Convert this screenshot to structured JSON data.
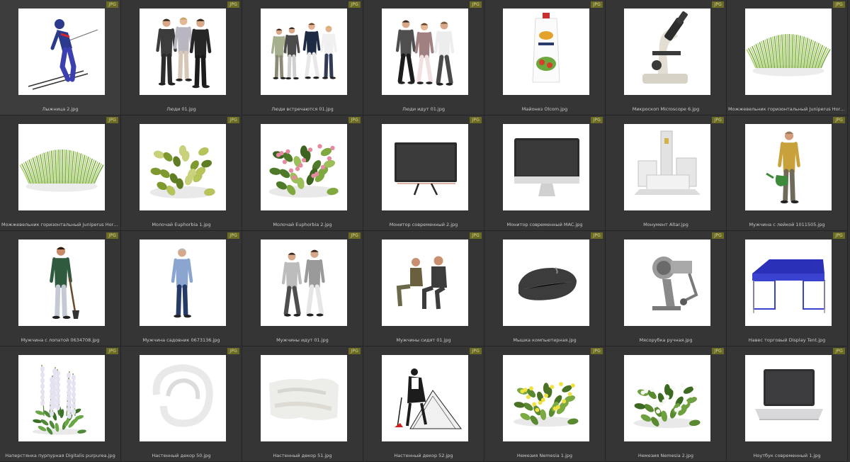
{
  "file_type_badge": "JPG",
  "items": [
    {
      "name": "Лыжница 2.jpg",
      "icon": "skier-icon"
    },
    {
      "name": "Люди 01.jpg",
      "icon": "people-group-icon"
    },
    {
      "name": "Люди встречаются 01.jpg",
      "icon": "people-meeting-icon"
    },
    {
      "name": "Люди идут 01.jpg",
      "icon": "people-walking-icon"
    },
    {
      "name": "Майонез Olcom.jpg",
      "icon": "mayonnaise-pack-icon"
    },
    {
      "name": "Микроскоп Microscope 6.jpg",
      "icon": "microscope-icon"
    },
    {
      "name": "Можжевельник горизонтальный Juniperus Horizontalis 2...",
      "icon": "juniper-shrub-icon"
    },
    {
      "name": "Можжевельник горизонтальный Juniperus Horizontalis 1...",
      "icon": "juniper-shrub-icon"
    },
    {
      "name": "Молочай Euphorbia 1.jpg",
      "icon": "euphorbia-plant-icon"
    },
    {
      "name": "Молочай Euphorbia 2.jpg",
      "icon": "euphorbia-plant-icon"
    },
    {
      "name": "Монитор современный 2.jpg",
      "icon": "monitor-icon"
    },
    {
      "name": "Монитор современный MAC.jpg",
      "icon": "imac-monitor-icon"
    },
    {
      "name": "Монумент Altar.jpg",
      "icon": "monument-icon"
    },
    {
      "name": "Мужчина с лейкой 1011505.jpg",
      "icon": "man-watering-can-icon"
    },
    {
      "name": "Мужчина с лопатой 0634708.jpg",
      "icon": "man-shovel-icon"
    },
    {
      "name": "Мужчина садовник 0673136.jpg",
      "icon": "man-gardener-icon"
    },
    {
      "name": "Мужчины идут 01.jpg",
      "icon": "men-walking-icon"
    },
    {
      "name": "Мужчины сидят 01.jpg",
      "icon": "men-sitting-icon"
    },
    {
      "name": "Мышка компьютерная.jpg",
      "icon": "computer-mouse-icon"
    },
    {
      "name": "Мясорубка ручная.jpg",
      "icon": "meat-grinder-icon"
    },
    {
      "name": "Навес торговый Display Tent.jpg",
      "icon": "display-tent-icon"
    },
    {
      "name": "Наперстянка пурпурная Digitalis purpurea.jpg",
      "icon": "foxglove-plant-icon"
    },
    {
      "name": "Настенный декор 50.jpg",
      "icon": "wall-decor-swirl-icon"
    },
    {
      "name": "Настенный декор 51.jpg",
      "icon": "wall-decor-panel-icon"
    },
    {
      "name": "Настенный декор 52.jpg",
      "icon": "wall-decor-banksy-icon"
    },
    {
      "name": "Немезия Nemesia 1.jpg",
      "icon": "nemesia-yellow-icon"
    },
    {
      "name": "Немезия Nemesia 2.jpg",
      "icon": "nemesia-white-icon"
    },
    {
      "name": "Ноутбук современный 1.jpg",
      "icon": "laptop-icon"
    }
  ]
}
